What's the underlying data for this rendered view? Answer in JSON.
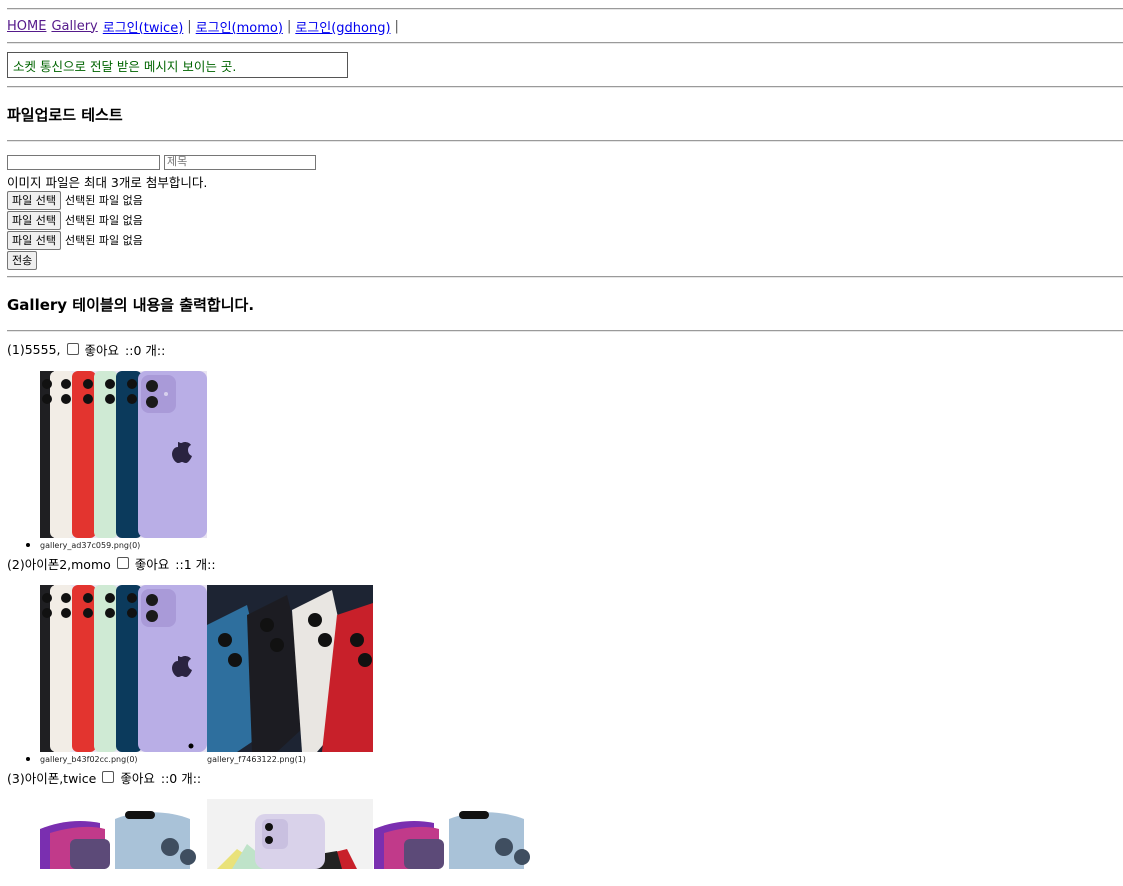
{
  "nav": {
    "home": "HOME",
    "gallery": "Gallery",
    "login_twice": "로그인(twice)",
    "login_momo": "로그인(momo)",
    "login_gdhong": "로그인(gdhong)",
    "sep": "|"
  },
  "socket_message": "소켓 통신으로 전달 받은 메시지 보이는 곳.",
  "upload": {
    "heading": "파일업로드 테스트",
    "title_placeholder": "제목",
    "hint": "이미지 파일은 최대 3개로 첨부합니다.",
    "file_button": "파일 선택",
    "no_file": "선택된 파일 없음",
    "submit": "전송"
  },
  "gallery": {
    "heading": "Gallery 테이블의 내용을 출력합니다.",
    "like_label": "좋아요",
    "items": [
      {
        "head": "(1)5555,",
        "count_text": "::0 개::",
        "captions": [
          "gallery_ad37c059.png(0)"
        ]
      },
      {
        "head": "(2)아이폰2,momo",
        "count_text": "::1 개::",
        "captions": [
          "gallery_b43f02cc.png(0)",
          "gallery_f7463122.png(1)"
        ]
      },
      {
        "head": "(3)아이폰,twice",
        "count_text": "::0 개::",
        "captions": []
      }
    ]
  }
}
